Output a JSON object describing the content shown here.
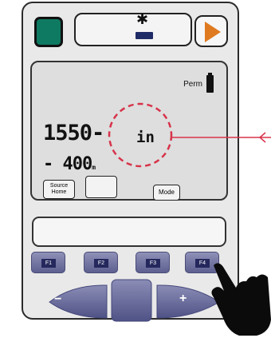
{
  "screen": {
    "perm_label": "Perm",
    "main_reading": "1550-",
    "secondary_reading": "- 400",
    "secondary_unit": "m",
    "center_value": "in",
    "source_label": "Source Home",
    "mode_label": "Mode"
  },
  "function_keys": [
    "F1",
    "F2",
    "F3",
    "F4"
  ],
  "nav": {
    "minus": "−",
    "plus": "+"
  },
  "colors": {
    "accent_green": "#0f7a62",
    "key_blue": "#5d5f8f",
    "highlight_red": "#d7334a",
    "play_orange": "#e07a20"
  }
}
